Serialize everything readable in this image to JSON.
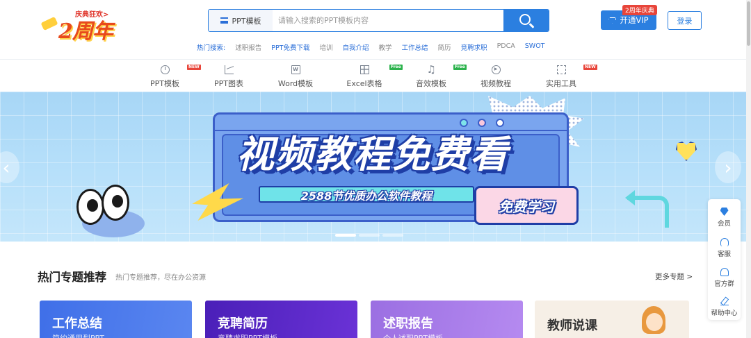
{
  "header": {
    "logo": {
      "tag": "庆典狂欢>",
      "wordmark": "2周年"
    },
    "search": {
      "category": "PPT模板",
      "placeholder": "请输入搜索的PPT模板内容"
    },
    "hot_searches": {
      "label": "热门搜索:",
      "keywords": [
        {
          "text": "述职报告",
          "blue": false
        },
        {
          "text": "PPT免费下载",
          "blue": true
        },
        {
          "text": "培训",
          "blue": false
        },
        {
          "text": "自我介绍",
          "blue": true
        },
        {
          "text": "教学",
          "blue": false
        },
        {
          "text": "工作总结",
          "blue": true
        },
        {
          "text": "简历",
          "blue": false
        },
        {
          "text": "竞聘求职",
          "blue": true
        },
        {
          "text": "PDCA",
          "blue": false
        },
        {
          "text": "SWOT",
          "blue": true
        }
      ]
    },
    "vip": {
      "label": "开通VIP",
      "badge": "2周年庆典"
    },
    "login_label": "登录"
  },
  "nav": {
    "items": [
      {
        "label": "PPT模板",
        "icon": "clock-icon",
        "badge": "NEW"
      },
      {
        "label": "PPT图表",
        "icon": "line-chart-icon",
        "badge": ""
      },
      {
        "label": "Word模板",
        "icon": "word-doc-icon",
        "badge": ""
      },
      {
        "label": "Excel表格",
        "icon": "table-icon",
        "badge": "Free"
      },
      {
        "label": "音效模板",
        "icon": "music-note-icon",
        "badge": "Free"
      },
      {
        "label": "视频教程",
        "icon": "play-circle-icon",
        "badge": ""
      },
      {
        "label": "实用工具",
        "icon": "tool-icon",
        "badge": "NEW"
      }
    ]
  },
  "banner": {
    "title": "视频教程免费看",
    "subtitle": "2588节优质办公软件教程",
    "tag": "免费学习",
    "slides_count": 3,
    "active_slide": 1
  },
  "section": {
    "title": "热门专题推荐",
    "subtitle": "热门专题推荐，尽在办公资源",
    "more_label": "更多专题 >"
  },
  "cards": [
    {
      "title": "工作总结",
      "subtitle": "简约通用型PPT"
    },
    {
      "title": "竞聘简历",
      "subtitle": "竞聘求职PPT模板"
    },
    {
      "title": "述职报告",
      "subtitle": "个人述职PPT模板"
    },
    {
      "title": "教师说课",
      "subtitle": ""
    }
  ],
  "right_toolbar": {
    "items": [
      {
        "label": "会员",
        "icon": "diamond-icon"
      },
      {
        "label": "客服",
        "icon": "headset-icon"
      },
      {
        "label": "官方群",
        "icon": "bell-icon"
      },
      {
        "label": "帮助中心",
        "icon": "edit-icon"
      }
    ]
  },
  "colors": {
    "primary": "#2b7fe0",
    "badge_red": "#e8453a",
    "badge_green": "#2bb24c",
    "banner_bg": "#b7e0fa"
  }
}
